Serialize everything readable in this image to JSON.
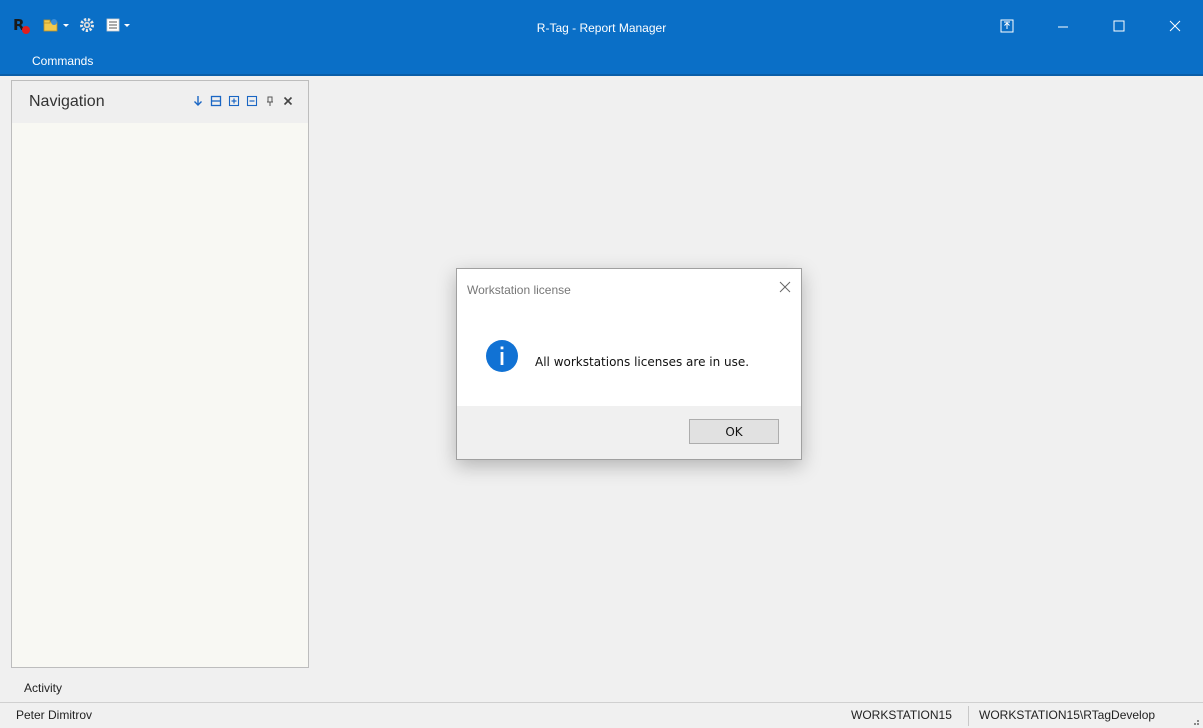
{
  "window": {
    "title": "R-Tag - Report Manager"
  },
  "ribbon": {
    "tabs": [
      {
        "label": "Commands"
      }
    ]
  },
  "quick_access": [
    {
      "icon": "rtag-logo-icon"
    },
    {
      "icon": "open-folder-icon",
      "has_dropdown": true
    },
    {
      "icon": "gear-icon"
    },
    {
      "icon": "layout-icon",
      "has_dropdown": true
    }
  ],
  "navigation": {
    "title": "Navigation"
  },
  "activity": {
    "label": "Activity"
  },
  "status": {
    "user": "Peter Dimitrov",
    "workstation": "WORKSTATION15",
    "database": "WORKSTATION15\\RTagDevelop"
  },
  "dialog": {
    "title": "Workstation license",
    "message": "All workstations licenses are in use.",
    "ok_label": "OK",
    "icon": "info-icon"
  },
  "colors": {
    "titlebar": "#0a6fc7",
    "info_icon": "#1172d4"
  }
}
